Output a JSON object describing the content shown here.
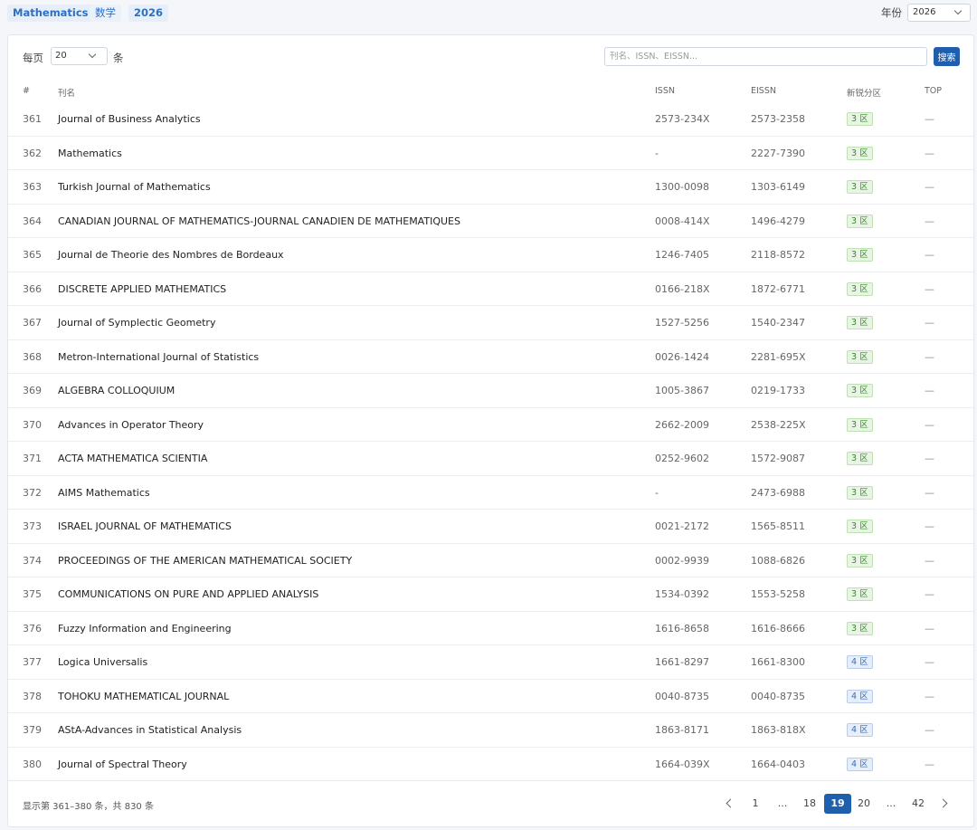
{
  "top": {
    "tags": [
      "Mathematics",
      "数学",
      "2026"
    ],
    "year_label": "年份",
    "year_value": "2026"
  },
  "controls": {
    "per_page_label": "每页",
    "per_page_value": "20",
    "per_page_unit": "条",
    "search_placeholder": "刊名、ISSN、EISSN...",
    "search_button": "搜索"
  },
  "table": {
    "headers": [
      "#",
      "刊名",
      "ISSN",
      "EISSN",
      "新锐分区",
      "TOP"
    ],
    "rows": [
      {
        "num": "361",
        "name": "Journal of Business Analytics",
        "issn": "2573-234X",
        "eissn": "2573-2358",
        "zone": "3 区",
        "top": "—"
      },
      {
        "num": "362",
        "name": "Mathematics",
        "issn": "-",
        "eissn": "2227-7390",
        "zone": "3 区",
        "top": "—"
      },
      {
        "num": "363",
        "name": "Turkish Journal of Mathematics",
        "issn": "1300-0098",
        "eissn": "1303-6149",
        "zone": "3 区",
        "top": "—"
      },
      {
        "num": "364",
        "name": "CANADIAN JOURNAL OF MATHEMATICS-JOURNAL CANADIEN DE MATHEMATIQUES",
        "issn": "0008-414X",
        "eissn": "1496-4279",
        "zone": "3 区",
        "top": "—"
      },
      {
        "num": "365",
        "name": "Journal de Theorie des Nombres de Bordeaux",
        "issn": "1246-7405",
        "eissn": "2118-8572",
        "zone": "3 区",
        "top": "—"
      },
      {
        "num": "366",
        "name": "DISCRETE APPLIED MATHEMATICS",
        "issn": "0166-218X",
        "eissn": "1872-6771",
        "zone": "3 区",
        "top": "—"
      },
      {
        "num": "367",
        "name": "Journal of Symplectic Geometry",
        "issn": "1527-5256",
        "eissn": "1540-2347",
        "zone": "3 区",
        "top": "—"
      },
      {
        "num": "368",
        "name": "Metron-International Journal of Statistics",
        "issn": "0026-1424",
        "eissn": "2281-695X",
        "zone": "3 区",
        "top": "—"
      },
      {
        "num": "369",
        "name": "ALGEBRA COLLOQUIUM",
        "issn": "1005-3867",
        "eissn": "0219-1733",
        "zone": "3 区",
        "top": "—"
      },
      {
        "num": "370",
        "name": "Advances in Operator Theory",
        "issn": "2662-2009",
        "eissn": "2538-225X",
        "zone": "3 区",
        "top": "—"
      },
      {
        "num": "371",
        "name": "ACTA MATHEMATICA SCIENTIA",
        "issn": "0252-9602",
        "eissn": "1572-9087",
        "zone": "3 区",
        "top": "—"
      },
      {
        "num": "372",
        "name": "AIMS Mathematics",
        "issn": "-",
        "eissn": "2473-6988",
        "zone": "3 区",
        "top": "—"
      },
      {
        "num": "373",
        "name": "ISRAEL JOURNAL OF MATHEMATICS",
        "issn": "0021-2172",
        "eissn": "1565-8511",
        "zone": "3 区",
        "top": "—"
      },
      {
        "num": "374",
        "name": "PROCEEDINGS OF THE AMERICAN MATHEMATICAL SOCIETY",
        "issn": "0002-9939",
        "eissn": "1088-6826",
        "zone": "3 区",
        "top": "—"
      },
      {
        "num": "375",
        "name": "COMMUNICATIONS ON PURE AND APPLIED ANALYSIS",
        "issn": "1534-0392",
        "eissn": "1553-5258",
        "zone": "3 区",
        "top": "—"
      },
      {
        "num": "376",
        "name": "Fuzzy Information and Engineering",
        "issn": "1616-8658",
        "eissn": "1616-8666",
        "zone": "3 区",
        "top": "—"
      },
      {
        "num": "377",
        "name": "Logica Universalis",
        "issn": "1661-8297",
        "eissn": "1661-8300",
        "zone": "4 区",
        "top": "—"
      },
      {
        "num": "378",
        "name": "TOHOKU MATHEMATICAL JOURNAL",
        "issn": "0040-8735",
        "eissn": "0040-8735",
        "zone": "4 区",
        "top": "—"
      },
      {
        "num": "379",
        "name": "AStA-Advances in Statistical Analysis",
        "issn": "1863-8171",
        "eissn": "1863-818X",
        "zone": "4 区",
        "top": "—"
      },
      {
        "num": "380",
        "name": "Journal of Spectral Theory",
        "issn": "1664-039X",
        "eissn": "1664-0403",
        "zone": "4 区",
        "top": "—"
      }
    ]
  },
  "footer": {
    "info": "显示第 361–380 条，共 830 条",
    "pages": [
      "1",
      "...",
      "18",
      "19",
      "20",
      "...",
      "42"
    ],
    "current_page": "19"
  },
  "colors": {
    "primary": "#1f5fae",
    "zone3": "#3b8a2f",
    "zone4": "#3a6cb5"
  }
}
